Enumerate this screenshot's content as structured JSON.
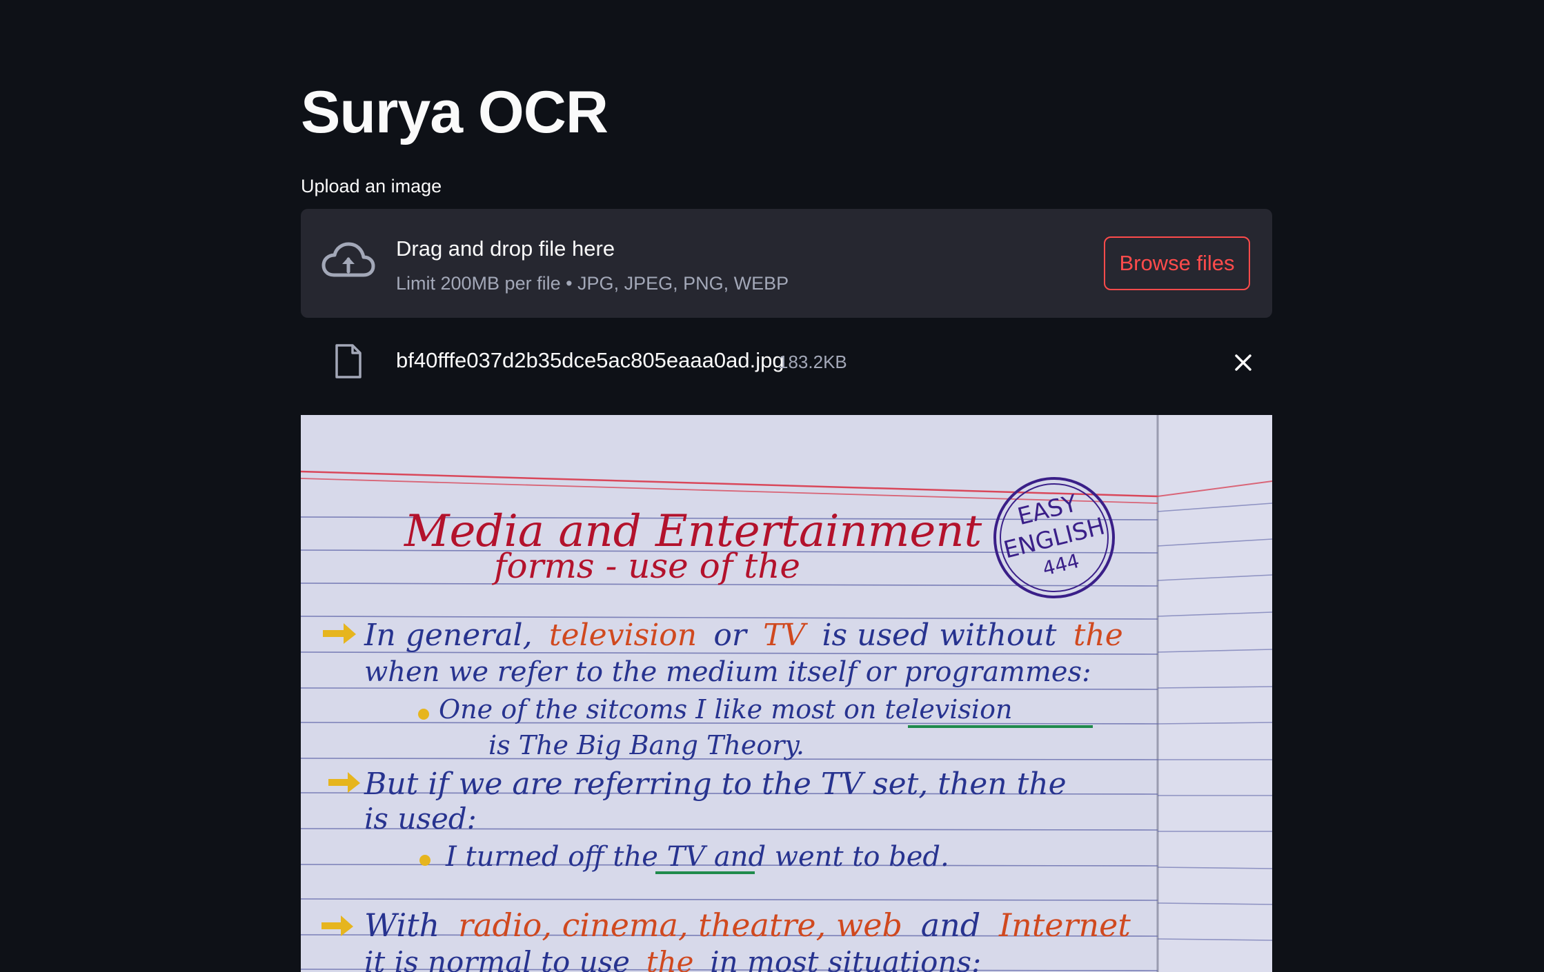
{
  "app": {
    "title": "Surya OCR"
  },
  "uploader": {
    "label": "Upload an image",
    "drop_title": "Drag and drop file here",
    "drop_hint": "Limit 200MB per file • JPG, JPEG, PNG, WEBP",
    "browse_label": "Browse files",
    "icon": "cloud-upload-icon"
  },
  "file": {
    "name": "bf40fffe037d2b35dce5ac805eaaa0ad.jpg",
    "size": "183.2KB",
    "icon": "file-icon",
    "remove_icon": "close-icon"
  },
  "image": {
    "title_line1": "Media and Entertainment",
    "title_line2": "forms - use of the",
    "stamp_top": "EASY",
    "stamp_middle": "ENGLISH",
    "stamp_bottom": "444",
    "p1_a": "In general,",
    "p1_b": "television",
    "p1_c": "or",
    "p1_d": "TV",
    "p1_e": "is used without",
    "p1_f": "the",
    "p1_line2": "when we refer to the medium itself or programmes:",
    "p1_example_line1": "One of the sitcoms I like most on television",
    "p1_example_line2": "is The Big Bang Theory.",
    "p2_line1": "But if we are referring to the TV set, then the",
    "p2_line2": "is used:",
    "p2_example": "I turned off the TV and went to bed.",
    "p3_a": "With",
    "p3_b": "radio, cinema, theatre, web",
    "p3_c": "and",
    "p3_d": "Internet",
    "p3_line2_a": "it is normal to use",
    "p3_line2_b": "the",
    "p3_line2_c": "in most situations:"
  },
  "colors": {
    "background": "#0e1117",
    "surface": "#262730",
    "accent": "#ff4b4b",
    "text": "#fafafa",
    "muted_text": "#a3a8b8"
  }
}
